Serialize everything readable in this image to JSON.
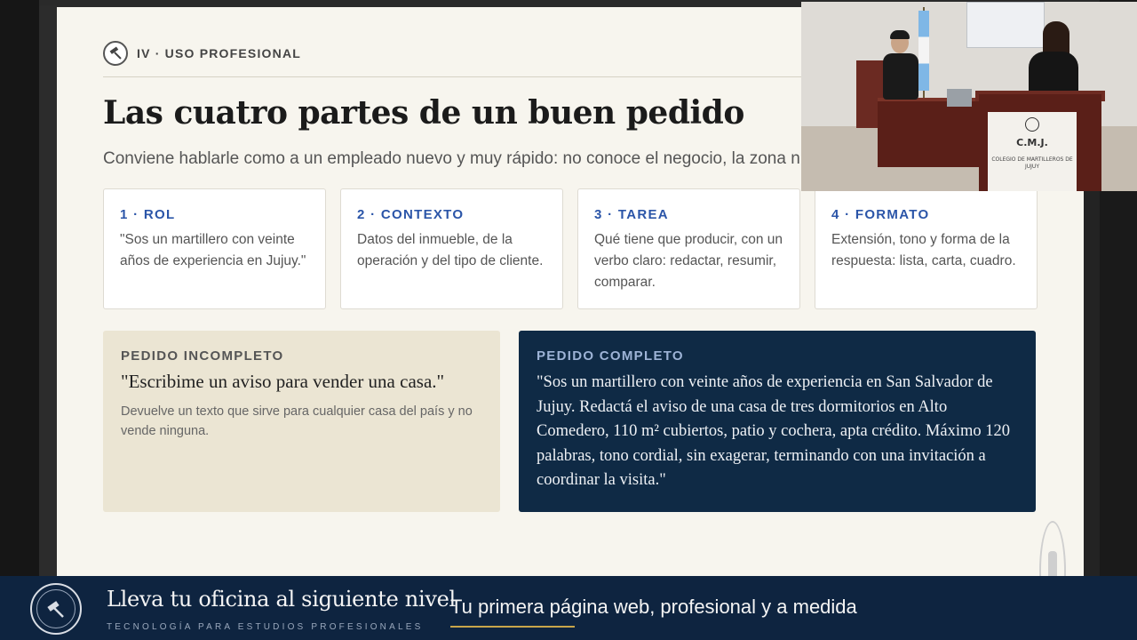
{
  "slide": {
    "section_label": "IV · USO PROFESIONAL",
    "title": "Las cuatro partes de un buen pedido",
    "subtitle": "Conviene hablarle como a un empleado nuevo y muy rápido: no conoce el negocio, la zona ni al c",
    "cards": [
      {
        "title": "1 · ROL",
        "body": "\"Sos un martillero con veinte años de experiencia en Jujuy.\""
      },
      {
        "title": "2 · CONTEXTO",
        "body": "Datos del inmueble, de la operación y del tipo de cliente."
      },
      {
        "title": "3 · TAREA",
        "body": "Qué tiene que producir, con un verbo claro: redactar, resumir, comparar."
      },
      {
        "title": "4 · FORMATO",
        "body": "Extensión, tono y forma de la respuesta: lista, carta, cuadro."
      }
    ],
    "incomplete": {
      "label": "PEDIDO INCOMPLETO",
      "quote": "\"Escribime un aviso para vender una casa.\"",
      "note": "Devuelve un texto que sirve para cualquier casa del país y no vende ninguna."
    },
    "complete": {
      "label": "PEDIDO COMPLETO",
      "quote": "\"Sos un martillero con veinte años de experiencia en San Salvador de Jujuy. Redactá el aviso de una casa de tres dormitorios en Alto Comedero, 110 m² cubiertos, patio y cochera, apta crédito. Máximo 120 palabras, tono cordial, sin exagerar, terminando con una invitación a coordinar la visita.\""
    }
  },
  "webcam": {
    "podium_title": "C.M.J.",
    "podium_sub": "COLEGIO DE MARTILLEROS DE JUJUY"
  },
  "banner": {
    "headline": "Lleva tu oficina al siguiente nivel",
    "tagline": "TECNOLOGÍA PARA ESTUDIOS PROFESIONALES",
    "right_text": "Tu primera página web, profesional y a medida"
  },
  "colors": {
    "accent_blue": "#2b55a8",
    "navy": "#0f2a45",
    "beige": "#ebe5d3",
    "gold": "#c8a54a"
  }
}
